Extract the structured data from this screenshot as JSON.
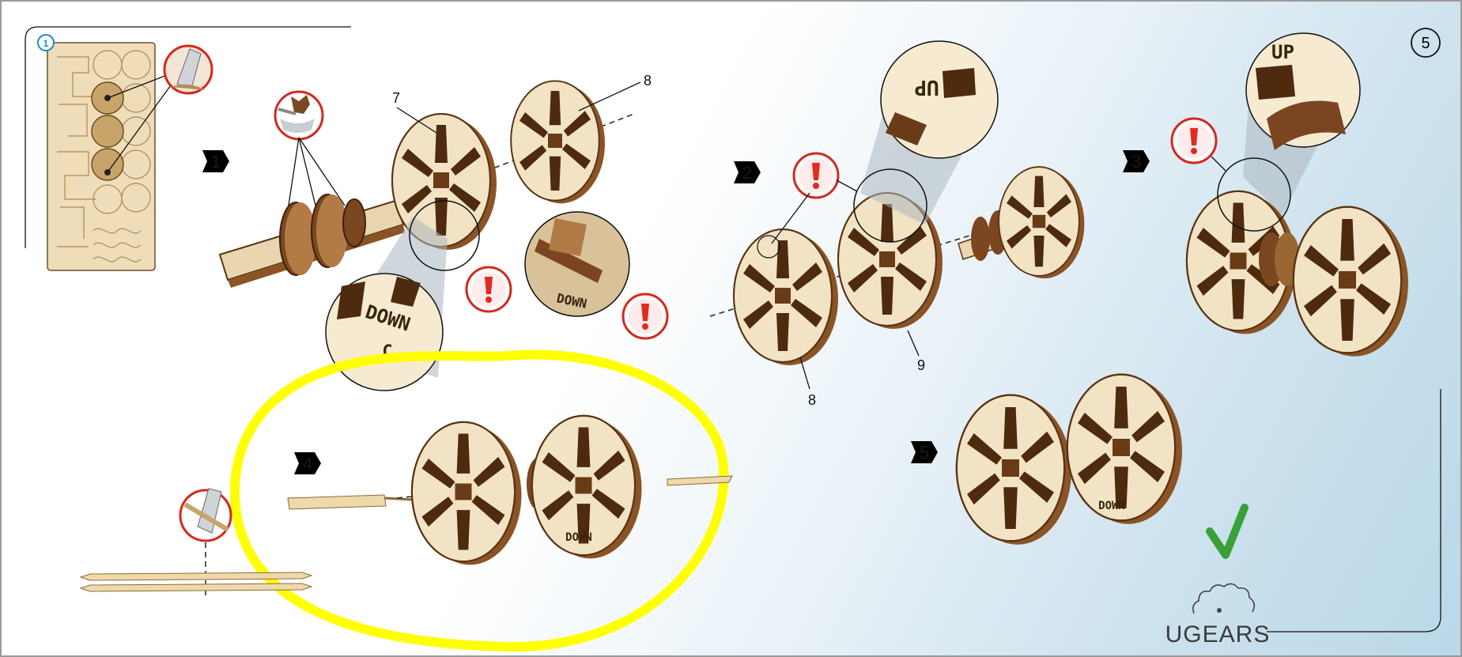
{
  "page_number": "5",
  "sheet_marker": "1",
  "steps": [
    {
      "num": "1"
    },
    {
      "num": "2"
    },
    {
      "num": "3"
    },
    {
      "num": "4"
    },
    {
      "num": "5"
    }
  ],
  "callouts": {
    "step1_part_a": "7",
    "step1_part_b": "8",
    "step2_part_a": "8",
    "step2_part_b": "9"
  },
  "engravings": {
    "down": "DOWN",
    "up": "UP",
    "c": "C"
  },
  "brand": "UGEARS",
  "highlight_color": "#ffff00",
  "step_badge_color": "#7cb342",
  "warning_color": "#e22b20",
  "checkmark_color": "#3aa13a"
}
